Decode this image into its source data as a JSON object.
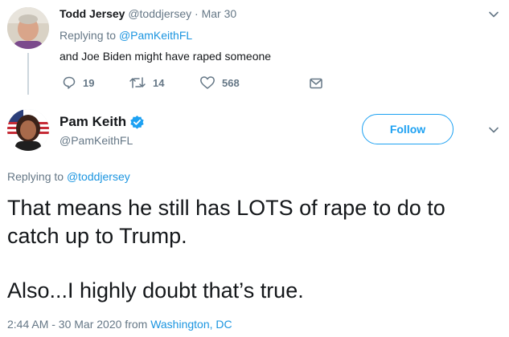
{
  "reply_tweet": {
    "display_name": "Todd Jersey",
    "handle": "@toddjersey",
    "separator": "·",
    "date": "Mar 30",
    "replying_to_prefix": "Replying to",
    "replying_to_handle": "@PamKeithFL",
    "text": "and Joe Biden might have raped someone",
    "replies": "19",
    "retweets": "14",
    "likes": "568"
  },
  "main_tweet": {
    "display_name": "Pam Keith",
    "handle": "@PamKeithFL",
    "verified": true,
    "follow_label": "Follow",
    "replying_to_prefix": "Replying to",
    "replying_to_handle": "@toddjersey",
    "text_line1": "That means he still has LOTS of rape to do to",
    "text_line2": "catch up to Trump.",
    "text_line3": "Also...I highly doubt that’s true.",
    "timestamp": "2:44 AM - 30 Mar 2020 from",
    "location": "Washington, DC"
  },
  "colors": {
    "accent": "#1da1f2",
    "link": "#1b95e0",
    "muted": "#657786",
    "text": "#14171a"
  }
}
